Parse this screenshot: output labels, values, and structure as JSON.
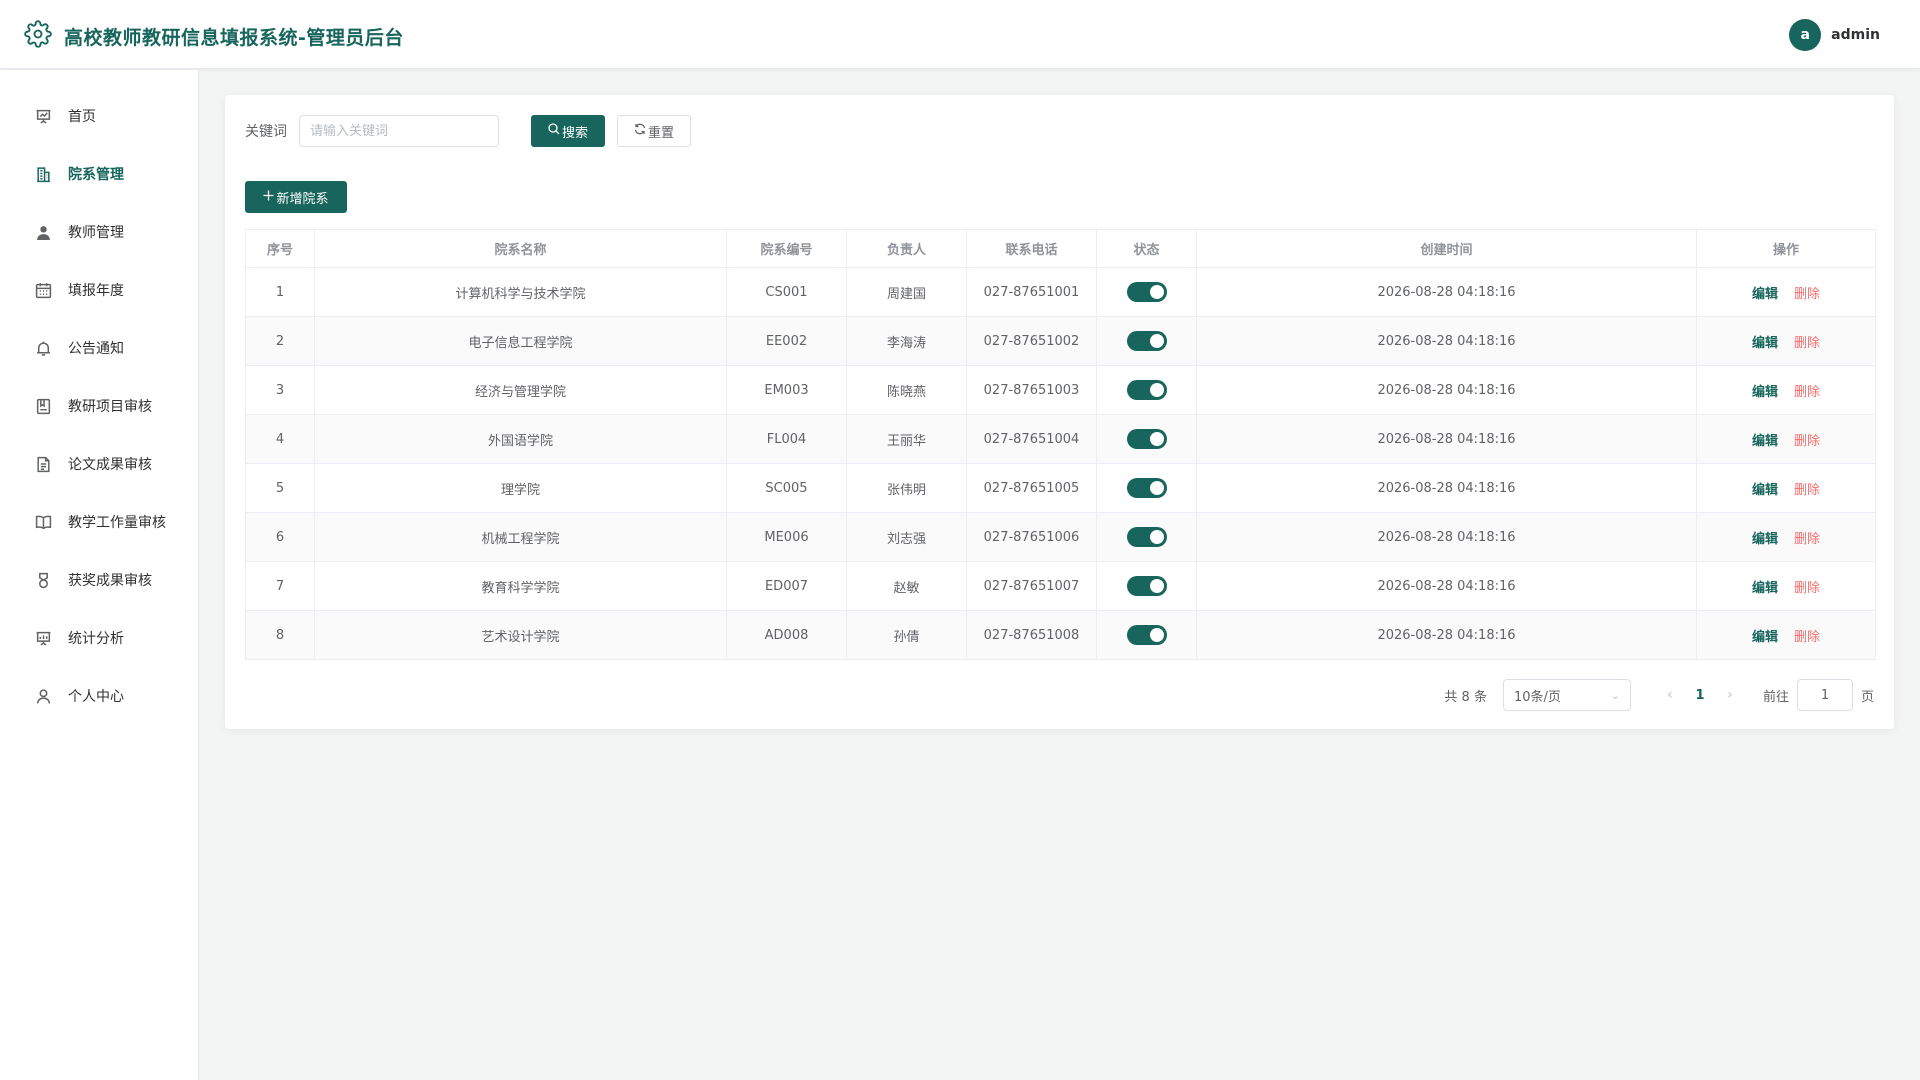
{
  "header": {
    "title": "高校教师教研信息填报系统-管理员后台",
    "avatar_letter": "a",
    "username": "admin"
  },
  "sidebar": {
    "items": [
      {
        "label": "首页",
        "icon": "presentation-icon"
      },
      {
        "label": "院系管理",
        "icon": "building-icon",
        "active": true
      },
      {
        "label": "教师管理",
        "icon": "user-icon"
      },
      {
        "label": "填报年度",
        "icon": "calendar-icon"
      },
      {
        "label": "公告通知",
        "icon": "bell-icon"
      },
      {
        "label": "教研项目审核",
        "icon": "notebook-icon"
      },
      {
        "label": "论文成果审核",
        "icon": "document-icon"
      },
      {
        "label": "教学工作量审核",
        "icon": "book-icon"
      },
      {
        "label": "获奖成果审核",
        "icon": "medal-icon"
      },
      {
        "label": "统计分析",
        "icon": "chart-board-icon"
      },
      {
        "label": "个人中心",
        "icon": "person-icon"
      }
    ]
  },
  "search": {
    "label": "关键词",
    "placeholder": "请输入关键词",
    "value": "",
    "search_button": "搜索",
    "reset_button": "重置"
  },
  "actions": {
    "add_button": "新增院系"
  },
  "table": {
    "columns": [
      "序号",
      "院系名称",
      "院系编号",
      "负责人",
      "联系电话",
      "状态",
      "创建时间",
      "操作"
    ],
    "rows": [
      {
        "index": "1",
        "name": "计算机科学与技术学院",
        "code": "CS001",
        "leader": "周建国",
        "phone": "027-87651001",
        "enabled": true,
        "created": "2026-08-28 04:18:16"
      },
      {
        "index": "2",
        "name": "电子信息工程学院",
        "code": "EE002",
        "leader": "李海涛",
        "phone": "027-87651002",
        "enabled": true,
        "created": "2026-08-28 04:18:16"
      },
      {
        "index": "3",
        "name": "经济与管理学院",
        "code": "EM003",
        "leader": "陈晓燕",
        "phone": "027-87651003",
        "enabled": true,
        "created": "2026-08-28 04:18:16"
      },
      {
        "index": "4",
        "name": "外国语学院",
        "code": "FL004",
        "leader": "王丽华",
        "phone": "027-87651004",
        "enabled": true,
        "created": "2026-08-28 04:18:16"
      },
      {
        "index": "5",
        "name": "理学院",
        "code": "SC005",
        "leader": "张伟明",
        "phone": "027-87651005",
        "enabled": true,
        "created": "2026-08-28 04:18:16"
      },
      {
        "index": "6",
        "name": "机械工程学院",
        "code": "ME006",
        "leader": "刘志强",
        "phone": "027-87651006",
        "enabled": true,
        "created": "2026-08-28 04:18:16"
      },
      {
        "index": "7",
        "name": "教育科学学院",
        "code": "ED007",
        "leader": "赵敏",
        "phone": "027-87651007",
        "enabled": true,
        "created": "2026-08-28 04:18:16"
      },
      {
        "index": "8",
        "name": "艺术设计学院",
        "code": "AD008",
        "leader": "孙倩",
        "phone": "027-87651008",
        "enabled": true,
        "created": "2026-08-28 04:18:16"
      }
    ],
    "edit_label": "编辑",
    "delete_label": "删除"
  },
  "pagination": {
    "total_text": "共 8 条",
    "page_size": "10条/页",
    "current_page": "1",
    "goto_label": "前往",
    "goto_value": "1",
    "page_unit": "页"
  },
  "colors": {
    "primary": "#17655c",
    "danger": "#f56c6c"
  }
}
